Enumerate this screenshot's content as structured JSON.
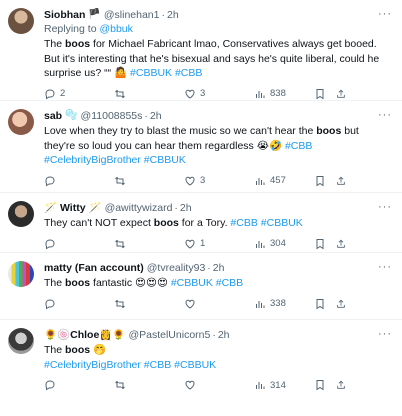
{
  "tweets": [
    {
      "name": "Siobhan",
      "badge": "🏴",
      "handle": "@slinehan1",
      "time": "2h",
      "replying_prefix": "Replying to ",
      "replying_to": "@bbuk",
      "text_before": "The ",
      "text_bold": "boos",
      "text_after": " for Michael Fabricant lmao, Conservatives always get booed. But it's interesting that he's bisexual and says he's quite liberal, could he surprise us? ““ 🤷 ",
      "tags": "#CBBUK #CBB",
      "replies": "2",
      "retweets": "",
      "likes": "3",
      "views": "838",
      "avatar_color": "#7a6a5a"
    },
    {
      "name": "sab",
      "badge": "🫧",
      "handle": "@11008855s",
      "time": "2h",
      "text_before": "Love when they try to blast the music so we can't hear the ",
      "text_bold": "boos",
      "text_after": " but they're so loud you can hear them regardless 😭🤣 ",
      "tags": "#CBB #CelebrityBigBrother #CBBUK",
      "replies": "",
      "retweets": "",
      "likes": "3",
      "views": "457",
      "avatar_color": "#c98a7a"
    },
    {
      "name": "🪄 Witty 🪄",
      "badge": "",
      "handle": "@awittywizard",
      "time": "2h",
      "text_before": "They can't NOT expect ",
      "text_bold": "boos",
      "text_after": " for a Tory. ",
      "tags": "#CBB #CBBUK",
      "replies": "",
      "retweets": "",
      "likes": "1",
      "views": "304",
      "avatar_color": "#3a3a3a"
    },
    {
      "name": "matty (Fan account)",
      "badge": "",
      "handle": "@tvreality93",
      "time": "2h",
      "text_before": "The ",
      "text_bold": "boos",
      "text_after": " fantastic 😍😍😍 ",
      "tags": "#CBBUK #CBB",
      "replies": "",
      "retweets": "",
      "likes": "",
      "views": "338",
      "avatar_color": "#9a6b8a"
    },
    {
      "name": "🌻🍥Chloe👸🌻",
      "badge": "",
      "handle": "@PastelUnicorn5",
      "time": "2h",
      "text_before": "The ",
      "text_bold": "boos",
      "text_after": " 🤭",
      "tags_line": "#CelebrityBigBrother #CBB #CBBUK",
      "tags": "",
      "replies": "",
      "retweets": "",
      "likes": "",
      "views": "314",
      "avatar_color": "#6f6f6f"
    }
  ]
}
